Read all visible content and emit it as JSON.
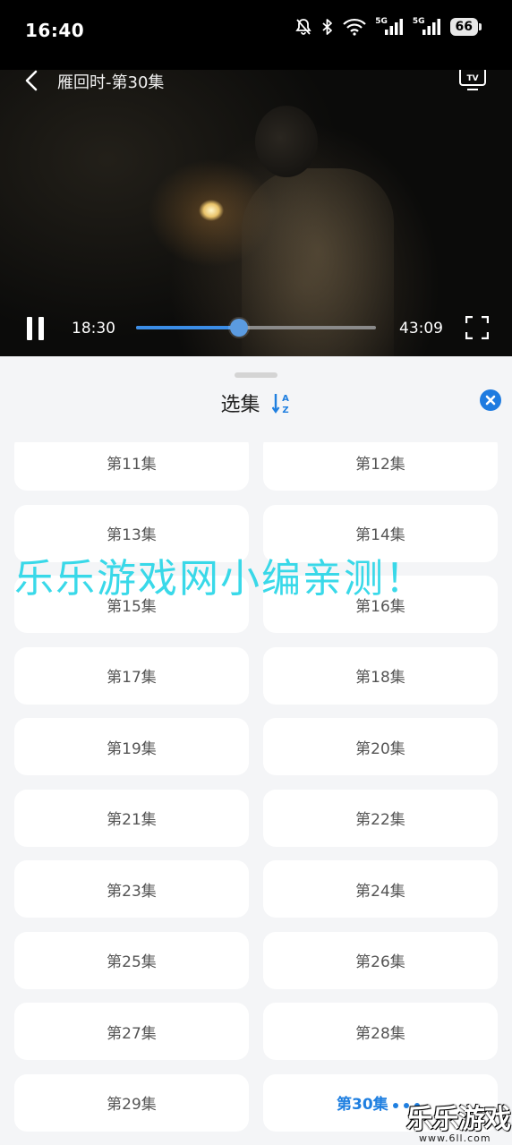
{
  "status_bar": {
    "time": "16:40",
    "signal1_label": "5G",
    "signal2_label": "5G",
    "battery": "66"
  },
  "player": {
    "title": "雁回时-第30集",
    "current_time": "18:30",
    "total_time": "43:09",
    "progress_fraction": 0.4287,
    "accent_color": "#3b8de6"
  },
  "episode_sheet": {
    "title": "选集",
    "sort_icon": "sort-az-icon",
    "close_icon": "close-icon",
    "accent_color": "#1f7fe0",
    "episodes": [
      {
        "label": "第11集",
        "active": false
      },
      {
        "label": "第12集",
        "active": false
      },
      {
        "label": "第13集",
        "active": false
      },
      {
        "label": "第14集",
        "active": false
      },
      {
        "label": "第15集",
        "active": false
      },
      {
        "label": "第16集",
        "active": false
      },
      {
        "label": "第17集",
        "active": false
      },
      {
        "label": "第18集",
        "active": false
      },
      {
        "label": "第19集",
        "active": false
      },
      {
        "label": "第20集",
        "active": false
      },
      {
        "label": "第21集",
        "active": false
      },
      {
        "label": "第22集",
        "active": false
      },
      {
        "label": "第23集",
        "active": false
      },
      {
        "label": "第24集",
        "active": false
      },
      {
        "label": "第25集",
        "active": false
      },
      {
        "label": "第26集",
        "active": false
      },
      {
        "label": "第27集",
        "active": false
      },
      {
        "label": "第28集",
        "active": false
      },
      {
        "label": "第29集",
        "active": false
      },
      {
        "label": "第30集",
        "active": true
      }
    ]
  },
  "watermark": {
    "text": "乐乐游戏网小编亲测！",
    "color": "#2fd7e8"
  },
  "logo": {
    "text": "乐乐游戏",
    "url_text": "www.6ll.com"
  }
}
